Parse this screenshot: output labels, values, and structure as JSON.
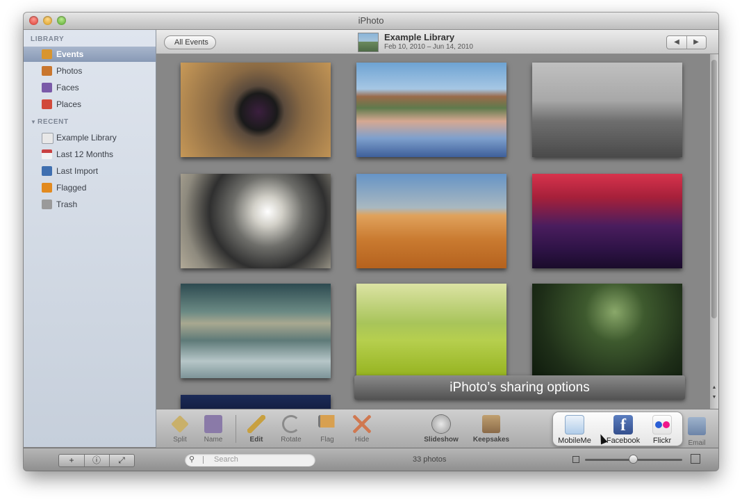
{
  "window": {
    "title": "iPhoto"
  },
  "sidebar": {
    "library_header": "LIBRARY",
    "recent_header": "RECENT",
    "library_items": [
      {
        "label": "Events",
        "icon": "events-icon",
        "color": "#d9952e",
        "selected": true
      },
      {
        "label": "Photos",
        "icon": "photos-icon",
        "color": "#c9762e",
        "selected": false
      },
      {
        "label": "Faces",
        "icon": "faces-icon",
        "color": "#7a5aa8",
        "selected": false
      },
      {
        "label": "Places",
        "icon": "places-icon",
        "color": "#d14a3b",
        "selected": false
      }
    ],
    "recent_items": [
      {
        "label": "Example Library",
        "icon": "library-icon",
        "color": "#e8e8e8"
      },
      {
        "label": "Last 12 Months",
        "icon": "calendar-icon",
        "color": "#c94040"
      },
      {
        "label": "Last Import",
        "icon": "import-icon",
        "color": "#3f6fb0"
      },
      {
        "label": "Flagged",
        "icon": "flag-icon",
        "color": "#e28a1f"
      },
      {
        "label": "Trash",
        "icon": "trash-icon",
        "color": "#9a9a9a"
      }
    ]
  },
  "header": {
    "back_label": "All Events",
    "library_title": "Example Library",
    "library_dates": "Feb 10, 2010 – Jun 14, 2010",
    "prev_label": "◀",
    "next_label": "▶"
  },
  "banner": {
    "text": "iPhoto’s sharing options"
  },
  "toolbar": {
    "items": [
      {
        "label": "Split",
        "icon": "split-icon",
        "color": "#c9b06a",
        "bold": false
      },
      {
        "label": "Name",
        "icon": "name-icon",
        "color": "#8a7aa8",
        "bold": false
      },
      {
        "label": "Edit",
        "icon": "pencil-icon",
        "color": "#c8a040",
        "bold": true
      },
      {
        "label": "Rotate",
        "icon": "rotate-icon",
        "color": "#8a8a8a",
        "bold": false
      },
      {
        "label": "Flag",
        "icon": "flag-icon",
        "color": "#d8a050",
        "bold": false
      },
      {
        "label": "Hide",
        "icon": "hide-icon",
        "color": "#d07850",
        "bold": false
      },
      {
        "label": "Slideshow",
        "icon": "play-icon",
        "color": "#6e6e6e",
        "bold": true
      },
      {
        "label": "Keepsakes",
        "icon": "keepsakes-icon",
        "color": "#b08a60",
        "bold": true
      }
    ],
    "email_label": "Email"
  },
  "share": {
    "items": [
      {
        "label": "MobileMe",
        "icon": "cloud-icon"
      },
      {
        "label": "Facebook",
        "icon": "facebook-icon",
        "glyph": "f"
      },
      {
        "label": "Flickr",
        "icon": "flickr-icon"
      }
    ],
    "flickr_colors": [
      "#2a5fd6",
      "#f0188a"
    ]
  },
  "bottom": {
    "add_label": "+",
    "info_label": "ⓘ",
    "fullscreen_label": "⤢",
    "search_placeholder": "Search",
    "photo_count": "33 photos"
  }
}
